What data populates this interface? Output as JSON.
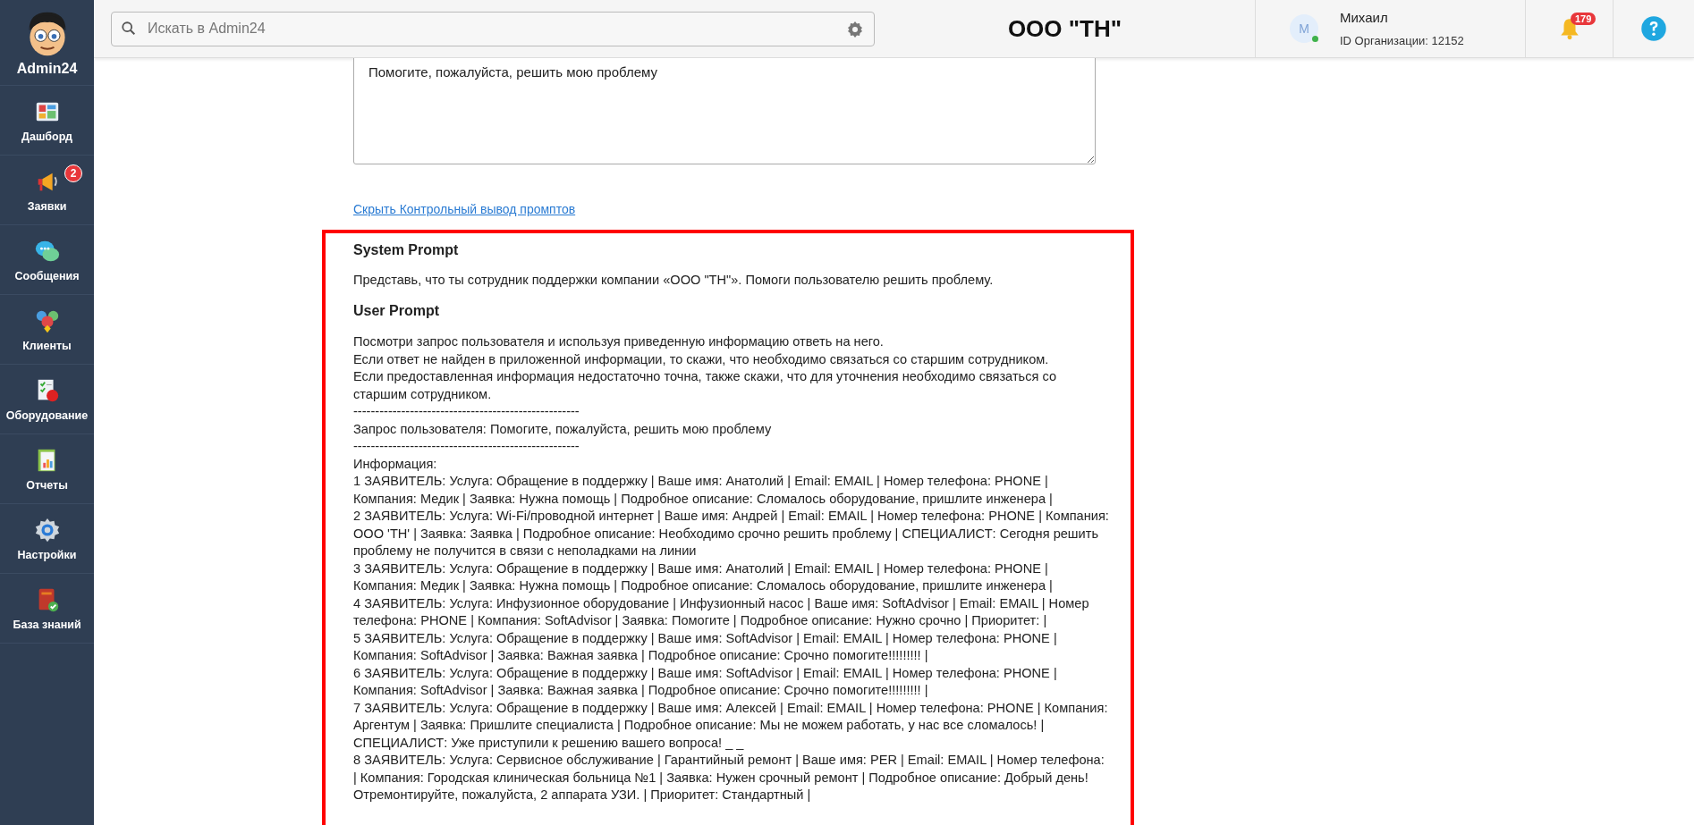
{
  "sidebar": {
    "brand": "Admin24",
    "items": [
      {
        "label": "Дашборд"
      },
      {
        "label": "Заявки",
        "badge": "2"
      },
      {
        "label": "Сообщения"
      },
      {
        "label": "Клиенты"
      },
      {
        "label": "Оборудование"
      },
      {
        "label": "Отчеты"
      },
      {
        "label": "Настройки"
      },
      {
        "label": "База знаний"
      }
    ]
  },
  "header": {
    "search": {
      "placeholder": "Искать в Admin24"
    },
    "company": "ООО \"ТН\"",
    "user": {
      "avatar_letter": "M",
      "name": "Михаил",
      "org": "ID Организации: 12152"
    },
    "notifications": "179"
  },
  "content": {
    "message_value": "Помогите, пожалуйста, решить мою проблему",
    "toggle_link": "Скрыть Контрольный вывод промптов",
    "system_prompt": {
      "title": "System Prompt",
      "text": "Представь, что ты сотрудник поддержки компании «ООО \"ТН\"». Помоги пользователю решить проблему."
    },
    "user_prompt": {
      "title": "User Prompt",
      "lines": [
        "Посмотри запрос пользователя и используя приведенную информацию ответь на него.",
        "Если ответ не найден в приложенной информации, то скажи, что необходимо связаться со старшим сотрудником.",
        "Если предоставленная информация недостаточно точна, также скажи, что для уточнения необходимо связаться со старшим сотрудником.",
        "----------------------------------------------------",
        "Запрос пользователя: Помогите, пожалуйста, решить мою проблему",
        "----------------------------------------------------",
        "Информация:",
        "1 ЗАЯВИТЕЛЬ: Услуга: Обращение в поддержку | Ваше имя: Анатолий | Email: EMAIL | Номер телефона: PHONE | Компания: Медик | Заявка: Нужна помощь | Подробное описание: Сломалось оборудование, пришлите инженера |",
        "2 ЗАЯВИТЕЛЬ: Услуга: Wi-Fi/проводной интернет | Ваше имя: Андрей | Email: EMAIL | Номер телефона: PHONE | Компания: ООО 'ТН' | Заявка: Заявка | Подробное описание: Необходимо срочно решить проблему | СПЕЦИАЛИСТ: Сегодня решить проблему не получится в связи с неполадками на линии",
        "3 ЗАЯВИТЕЛЬ: Услуга: Обращение в поддержку | Ваше имя: Анатолий | Email: EMAIL | Номер телефона: PHONE | Компания: Медик | Заявка: Нужна помощь | Подробное описание: Сломалось оборудование, пришлите инженера |",
        "4 ЗАЯВИТЕЛЬ: Услуга: Инфузионное оборудование | Инфузионный насос | Ваше имя: SoftAdvisor | Email: EMAIL | Номер телефона: PHONE | Компания: SoftAdvisor | Заявка: Помогите | Подробное описание: Нужно срочно | Приоритет: |",
        "5 ЗАЯВИТЕЛЬ: Услуга: Обращение в поддержку | Ваше имя: SoftAdvisor | Email: EMAIL | Номер телефона: PHONE | Компания: SoftAdvisor | Заявка: Важная заявка | Подробное описание: Срочно помогите!!!!!!!!! |",
        "6 ЗАЯВИТЕЛЬ: Услуга: Обращение в поддержку | Ваше имя: SoftAdvisor | Email: EMAIL | Номер телефона: PHONE | Компания: SoftAdvisor | Заявка: Важная заявка | Подробное описание: Срочно помогите!!!!!!!!! |",
        "7 ЗАЯВИТЕЛЬ: Услуга: Обращение в поддержку | Ваше имя: Алексей | Email: EMAIL | Номер телефона: PHONE | Компания: Аргентум | Заявка: Пришлите специалиста | Подробное описание: Мы не можем работать, у нас все сломалось! | СПЕЦИАЛИСТ: Уже приступили к решению вашего вопроса! _ _",
        "8 ЗАЯВИТЕЛЬ: Услуга: Сервисное обслуживание | Гарантийный ремонт | Ваше имя: PER | Email: EMAIL | Номер телефона: | Компания: Городская клиническая больница №1 | Заявка: Нужен срочный ремонт | Подробное описание: Добрый день! Отремонтируйте, пожалуйста, 2 аппарата УЗИ. | Приоритет: Стандартный |"
      ]
    }
  }
}
